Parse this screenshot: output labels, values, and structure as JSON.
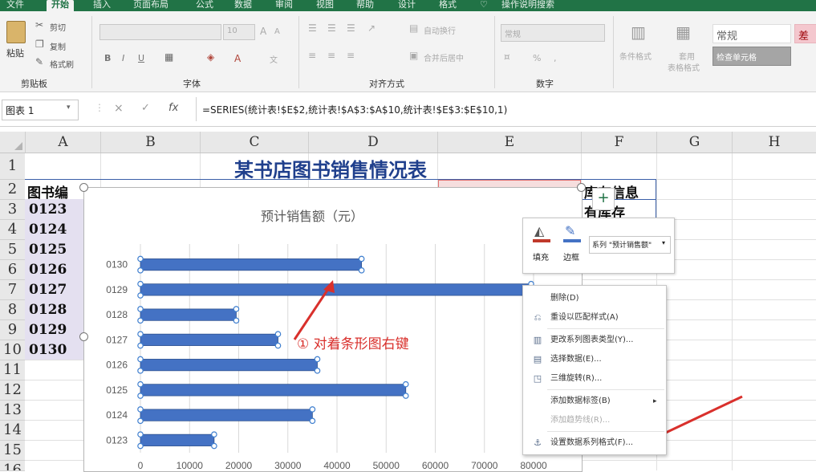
{
  "ribbon": {
    "tabs": [
      "文件",
      "开始",
      "插入",
      "页面布局",
      "公式",
      "数据",
      "审阅",
      "视图",
      "帮助",
      "设计",
      "格式",
      "操作说明搜索"
    ],
    "active_tab": "开始",
    "clipboard": {
      "paste": "粘贴",
      "cut": "剪切",
      "copy": "复制",
      "format_painter": "格式刷",
      "label": "剪贴板"
    },
    "font": {
      "size": "10",
      "bold": "B",
      "italic": "I",
      "underline": "U",
      "grow": "A",
      "shrink": "A",
      "font_color": "A",
      "phonetic": "文",
      "label": "字体"
    },
    "alignment": {
      "wrap": "自动换行",
      "merge": "合并后居中",
      "label": "对齐方式"
    },
    "number": {
      "format": "常规",
      "percent": "%",
      "comma": ",",
      "label": "数字"
    },
    "styles": {
      "conditional": "条件格式",
      "table_format_1": "套用",
      "table_format_2": "表格格式",
      "normal": "常规",
      "check_cell": "检查单元格",
      "bad": "差"
    }
  },
  "formula_bar": {
    "name_box": "图表 1",
    "cancel": "×",
    "enter": "✓",
    "fx": "fx",
    "formula": "=SERIES(统计表!$E$2,统计表!$A$3:$A$10,统计表!$E$3:$E$10,1)"
  },
  "sheet": {
    "columns": [
      "A",
      "B",
      "C",
      "D",
      "E",
      "F",
      "G",
      "H"
    ],
    "rows": [
      "1",
      "2",
      "3",
      "4",
      "5",
      "6",
      "7",
      "8",
      "9",
      "10",
      "11",
      "12",
      "13",
      "14",
      "15",
      "16"
    ],
    "title": "某书店图书销售情况表",
    "a2": "图书编",
    "f2": "库存信息",
    "f3": "有库存",
    "book_ids": [
      "0123",
      "0124",
      "0125",
      "0126",
      "0127",
      "0128",
      "0129",
      "0130"
    ]
  },
  "chart_data": {
    "type": "bar",
    "title": "预计销售额（元）",
    "categories": [
      "0123",
      "0124",
      "0125",
      "0126",
      "0127",
      "0128",
      "0129",
      "0130"
    ],
    "values": [
      15000,
      35000,
      54000,
      36000,
      28000,
      19500,
      79500,
      45000
    ],
    "xlim": [
      0,
      80000
    ],
    "xticks": [
      "0",
      "10000",
      "20000",
      "30000",
      "40000",
      "50000",
      "60000",
      "70000",
      "80000"
    ],
    "bar_color": "#4472c4",
    "grid": true
  },
  "annotation": {
    "text": "① 对着条形图右键",
    "color": "#d9302c"
  },
  "mini_toolbar": {
    "fill": "填充",
    "outline": "边框",
    "series_select": "系列 \"预计销售额\""
  },
  "context_menu": {
    "items": [
      {
        "label": "删除(D)",
        "icon": "delete-icon"
      },
      {
        "label": "重设以匹配样式(A)",
        "icon": "reset-icon"
      },
      {
        "label": "更改系列图表类型(Y)...",
        "icon": "chart-type-icon"
      },
      {
        "label": "选择数据(E)...",
        "icon": "select-data-icon"
      },
      {
        "label": "三维旋转(R)...",
        "icon": "rotate-3d-icon"
      },
      {
        "label": "添加数据标签(B)",
        "icon": "data-label-icon"
      },
      {
        "label": "添加趋势线(R)...",
        "icon": "trendline-icon"
      },
      {
        "label": "设置数据系列格式(F)...",
        "icon": "format-series-icon"
      }
    ]
  },
  "colors": {
    "excel_green": "#217346",
    "series_blue": "#4472c4",
    "arrow_red": "#d9302c"
  }
}
